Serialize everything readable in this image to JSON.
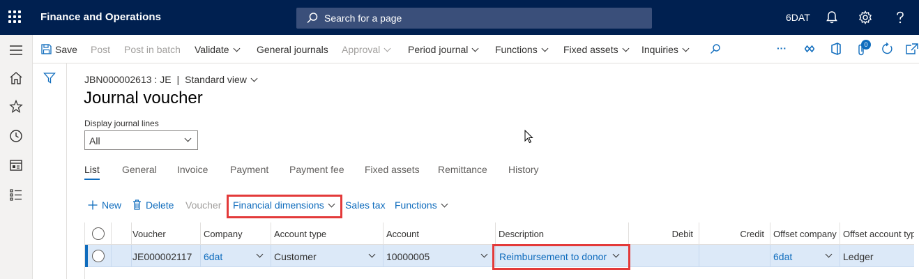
{
  "app": {
    "title": "Finance and Operations",
    "search_placeholder": "Search for a page",
    "company": "6DAT"
  },
  "icons": {
    "waffle": "waffle-icon",
    "search": "search-icon",
    "bell": "bell-icon",
    "gear": "gear-icon",
    "help": "help-icon",
    "hamburger": "hamburger-icon",
    "home": "home-icon",
    "star": "star-icon",
    "clock": "clock-icon",
    "workspace": "workspace-icon",
    "list": "list-icon",
    "filter": "filter-icon"
  },
  "actionpane": {
    "save": "Save",
    "post": "Post",
    "post_in_batch": "Post in batch",
    "validate": "Validate",
    "general_journals": "General journals",
    "approval": "Approval",
    "period_journal": "Period journal",
    "functions": "Functions",
    "fixed_assets": "Fixed assets",
    "inquiries": "Inquiries",
    "more": "···",
    "attachments_count": "0"
  },
  "page": {
    "breadcrumb_record": "JBN000002613 : JE",
    "breadcrumb_sep": "|",
    "view": "Standard view",
    "title": "Journal voucher",
    "display_lines_label": "Display journal lines",
    "display_lines_value": "All"
  },
  "tabs": [
    "List",
    "General",
    "Invoice",
    "Payment",
    "Payment fee",
    "Fixed assets",
    "Remittance",
    "History"
  ],
  "grid_actions": {
    "new": "New",
    "delete": "Delete",
    "voucher": "Voucher",
    "financial_dimensions": "Financial dimensions",
    "sales_tax": "Sales tax",
    "functions": "Functions"
  },
  "grid": {
    "headers": [
      "Voucher",
      "Company",
      "Account type",
      "Account",
      "Description",
      "Debit",
      "Credit",
      "Offset company",
      "Offset account type"
    ],
    "row": {
      "voucher": "JE000002117",
      "company": "6dat",
      "account_type": "Customer",
      "account": "10000005",
      "description": "Reimbursement to donor",
      "debit": "",
      "credit": "",
      "offset_company": "6dat",
      "offset_account_type": "Ledger"
    }
  },
  "colors": {
    "topbar": "#002050",
    "accent": "#0f6cbd",
    "highlight": "#e33a3a",
    "selected_row": "#dce9f8"
  }
}
